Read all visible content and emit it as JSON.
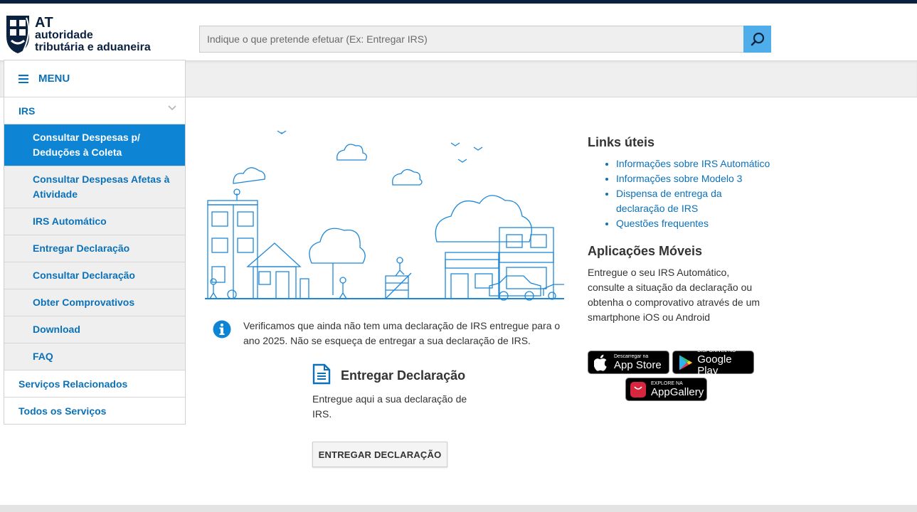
{
  "header": {
    "logo": {
      "abbr": "AT",
      "line1": "autoridade",
      "line2": "tributária e aduaneira"
    },
    "search": {
      "placeholder": "Indique o que pretende efetuar (Ex: Entregar IRS)"
    }
  },
  "sidebar": {
    "menu_label": "MENU",
    "section": "IRS",
    "sub_items": [
      {
        "label": "Consultar Despesas p/ Deduções à Coleta",
        "active": true
      },
      {
        "label": "Consultar Despesas Afetas à Atividade",
        "active": false
      },
      {
        "label": "IRS Automático",
        "active": false
      },
      {
        "label": "Entregar Declaração",
        "active": false
      },
      {
        "label": "Consultar Declaração",
        "active": false
      },
      {
        "label": "Obter Comprovativos",
        "active": false
      },
      {
        "label": "Download",
        "active": false
      },
      {
        "label": "FAQ",
        "active": false
      }
    ],
    "bottom_items": [
      "Serviços Relacionados",
      "Todos os Serviços"
    ]
  },
  "main": {
    "info_message": "Verificamos que ainda não tem uma declaração de IRS entregue para o ano 2025. Não se esqueça de entregar a sua declaração de IRS.",
    "card": {
      "title": "Entregar Declaração",
      "description": "Entregue aqui a sua declaração de IRS.",
      "button": "ENTREGAR DECLARAÇÃO"
    }
  },
  "aside": {
    "links_title": "Links úteis",
    "links": [
      "Informações sobre IRS Automático",
      "Informações sobre Modelo 3",
      "Dispensa de entrega da declaração de IRS",
      "Questões frequentes"
    ],
    "apps_title": "Aplicações Móveis",
    "apps_desc": "Entregue o seu IRS Automático, consulte a situação da declaração ou obtenha o comprovativo através de um smartphone iOS ou Android",
    "badges": {
      "appstore_small": "Descarregar na",
      "appstore_big": "App Store",
      "googleplay_small": "DISPONÍVEL NO",
      "googleplay_big": "Google Play",
      "appgallery_small": "EXPLORE NA",
      "appgallery_big": "AppGallery"
    }
  },
  "colors": {
    "navy": "#0b2140",
    "link": "#0b71b8",
    "active": "#0d84d4",
    "search_btn": "#4faee9",
    "illustration": "#1e88d8"
  }
}
